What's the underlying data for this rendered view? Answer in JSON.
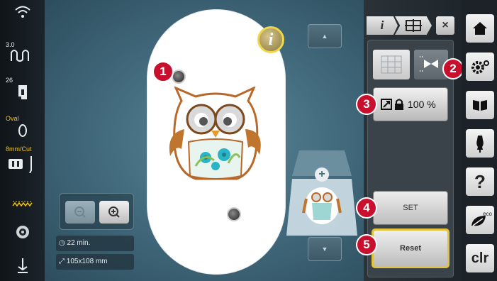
{
  "left_status": {
    "tension_value": "3.0",
    "stitch_value": "26",
    "hoop_label": "Oval",
    "needle_label": "8mm/Cut"
  },
  "canvas": {
    "info_label": "i",
    "stitch_time": "22 min.",
    "design_size": "105x108 mm"
  },
  "right_panel": {
    "tab_info_label": "i",
    "close_label": "×",
    "scale_value": "100 %",
    "set_label": "SET",
    "reset_label": "Reset"
  },
  "badges": [
    "1",
    "2",
    "3",
    "4",
    "5"
  ],
  "side_menu": {
    "help_label": "?",
    "eco_label": "eco",
    "clear_label": "clr"
  },
  "colors": {
    "badge_red": "#c8102e",
    "highlight_yellow": "#e2c33e",
    "canvas_blue": "#4a7386"
  }
}
